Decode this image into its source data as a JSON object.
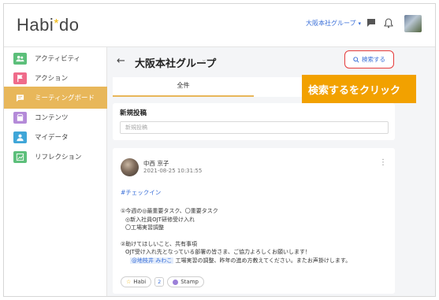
{
  "header": {
    "logo_text": "Habi",
    "logo_star": "*",
    "logo_suffix": "do",
    "org_select": "大阪本社グループ",
    "org_caret": "▾"
  },
  "sidebar": {
    "items": [
      {
        "label": "アクティビティ",
        "icon": "people-icon",
        "color": "#5cbf7a"
      },
      {
        "label": "アクション",
        "icon": "flag-icon",
        "color": "#ef6b8a"
      },
      {
        "label": "ミーティングボード",
        "icon": "chat-icon",
        "color": "#e8b75a",
        "active": true
      },
      {
        "label": "コンテンツ",
        "icon": "box-icon",
        "color": "#b48ad8"
      },
      {
        "label": "マイデータ",
        "icon": "person-icon",
        "color": "#3fa6d8"
      },
      {
        "label": "リフレクション",
        "icon": "chart-icon",
        "color": "#5cbf7a"
      }
    ]
  },
  "page": {
    "back": "←",
    "title": "大阪本社グループ",
    "title_caret": "⌄",
    "search_icon": "🔍",
    "search_label": "検索する"
  },
  "tabs": [
    {
      "label": "全件",
      "active": true
    },
    {
      "label": "",
      "active": false
    }
  ],
  "callout": "検索するをクリック",
  "new_post": {
    "title": "新規投稿",
    "placeholder": "新規投稿"
  },
  "post": {
    "author": "中西 京子",
    "date": "2021-08-25 10:31:55",
    "menu": "⋮",
    "hashtag": "#チェックイン",
    "line1": "①今週の◎最重要タスク、〇重要タスク",
    "line2": "◎新入社員OJT研修受け入れ",
    "line3": "〇工場実習調整",
    "line4": "②助けてほしいこと、共有事項",
    "line5": "OJT受け入れ先となっている部署の皆さま、ご協力よろしくお願いします！",
    "mention": "@地枝井 みわこ",
    "line6_rest": " 工場実習の調整、昨年の進め方教えてください。またお声掛けします。",
    "reaction_habi_icon": "☆",
    "reaction_habi_label": "Habi",
    "reaction_count": "2",
    "reaction_stamp_label": "Stamp"
  }
}
